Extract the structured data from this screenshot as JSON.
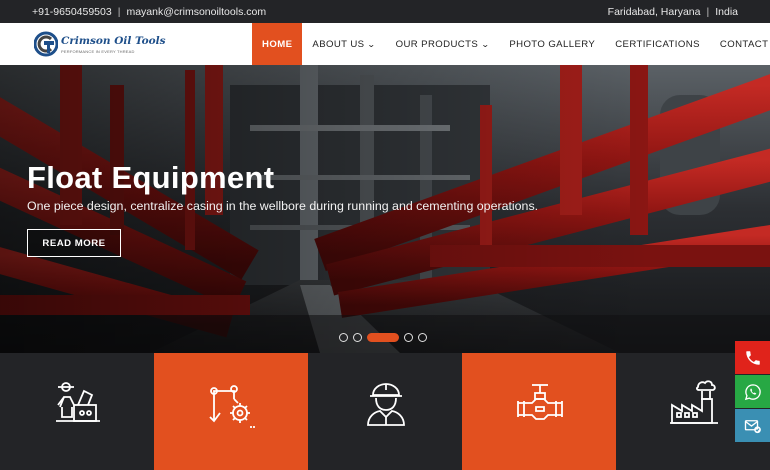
{
  "topbar": {
    "phone": "+91-9650459503",
    "email": "mayank@crimsonoiltools.com",
    "city": "Faridabad, Haryana",
    "country": "India"
  },
  "brand": {
    "name": "Crimson Oil Tools",
    "tagline": "PERFORMANCE IN EVERY THREAD"
  },
  "nav": {
    "items": [
      {
        "label": "HOME",
        "active": true,
        "dropdown": false
      },
      {
        "label": "ABOUT US",
        "active": false,
        "dropdown": true
      },
      {
        "label": "OUR PRODUCTS",
        "active": false,
        "dropdown": true
      },
      {
        "label": "PHOTO GALLERY",
        "active": false,
        "dropdown": false
      },
      {
        "label": "CERTIFICATIONS",
        "active": false,
        "dropdown": false
      },
      {
        "label": "CONTACT US",
        "active": false,
        "dropdown": false
      }
    ]
  },
  "hero": {
    "title": "Float Equipment",
    "subtitle": "One piece design, centralize casing in the wellbore during running and cementing operations.",
    "button": "READ MORE",
    "slides": 5,
    "active_slide": 3
  },
  "tiles": [
    {
      "icon": "engineer-machinery-icon",
      "style": "dark"
    },
    {
      "icon": "robotic-arm-gear-icon",
      "style": "orange"
    },
    {
      "icon": "worker-hardhat-icon",
      "style": "dark"
    },
    {
      "icon": "pipe-valve-icon",
      "style": "orange"
    },
    {
      "icon": "factory-icon",
      "style": "dark"
    }
  ],
  "floating": [
    {
      "icon": "phone-icon",
      "color": "#e0231b"
    },
    {
      "icon": "whatsapp-icon",
      "color": "#27a844"
    },
    {
      "icon": "email-icon",
      "color": "#3a8fb3"
    }
  ],
  "colors": {
    "accent": "#e2501f",
    "dark": "#232427",
    "topbar": "#232427"
  }
}
